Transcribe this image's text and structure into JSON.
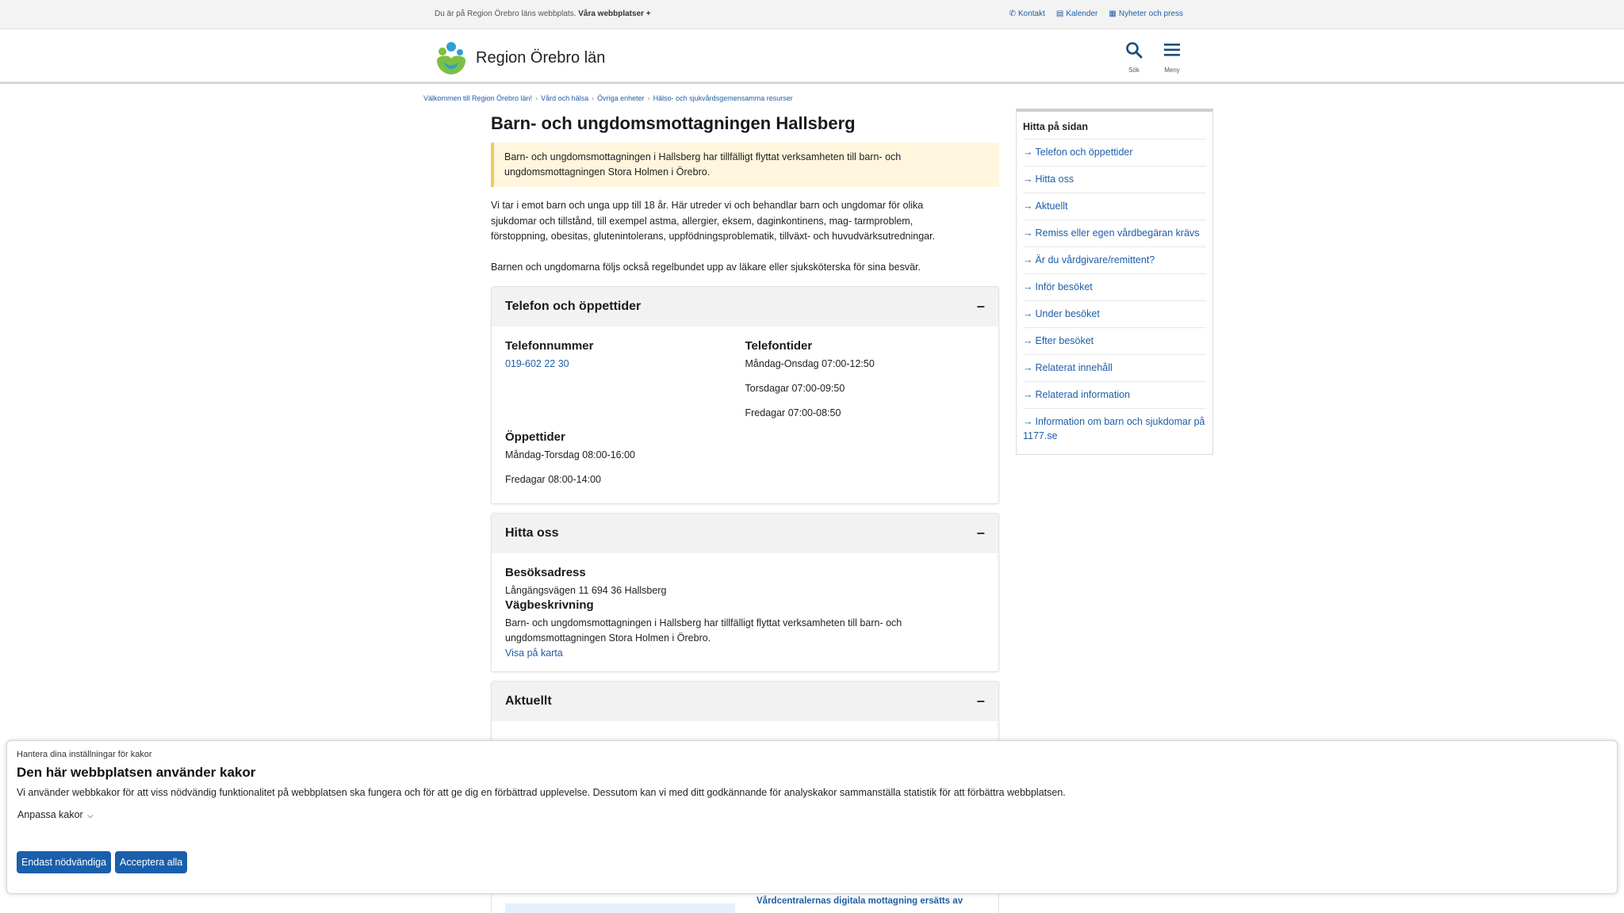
{
  "topbar": {
    "intro": "Du är på Region Örebro läns webbplats.",
    "our_sites": "Våra webbplatser +",
    "links": [
      {
        "icon": "phone-icon",
        "glyph": "📞",
        "label": "Kontakt"
      },
      {
        "icon": "calendar-icon",
        "glyph": "📅",
        "label": "Kalender"
      },
      {
        "icon": "news-icon",
        "glyph": "📰",
        "label": "Nyheter och press"
      }
    ]
  },
  "header": {
    "site_name": "Region Örebro län",
    "search_label": "Sök",
    "menu_label": "Meny"
  },
  "breadcrumb": [
    "Välkommen till Region Örebro län!",
    "Vård och hälsa",
    "Övriga enheter",
    "Hälso- och sjukvårdsgemensamma resurser"
  ],
  "page": {
    "title": "Barn- och ungdomsmottagningen Hallsberg",
    "notice_line1": "Barn- och ungdomsmottagningen i Hallsberg har tillfälligt flyttat verksamheten till barn- och",
    "notice_line2": "ungdomsmottagningen Stora Holmen i Örebro.",
    "intro_line1": "Vi tar i emot barn och unga upp till 18 år. Här utreder vi och behandlar barn och ungdomar för olika",
    "intro_line2": "sjukdomar och tillstånd, till exempel astma, allergier, eksem, daginkontinens, mag- tarmproblem,",
    "intro_line3": "förstoppning, obesitas, glutenintolerans, uppfödningsproblematik, tillväxt- och huvudvärksutredningar.",
    "followup": "Barnen och ungdomarna följs också regelbundet upp av läkare eller sjuksköterska för sina besvär."
  },
  "phone_section": {
    "title": "Telefon och öppettider",
    "toggle": "−",
    "phone_heading": "Telefonnummer",
    "phone_number": "019-602 22 30",
    "phone_times_heading": "Telefontider",
    "phone_times": [
      "Måndag-Onsdag 07:00-12:50",
      "Torsdagar 07:00-09:50",
      "Fredagar 07:00-08:50"
    ],
    "open_heading": "Öppettider",
    "open_times": [
      "Måndag-Torsdag 08:00-16:00",
      "Fredagar 08:00-14:00"
    ]
  },
  "find_section": {
    "title": "Hitta oss",
    "toggle": "−",
    "visit_heading": "Besöksadress",
    "visit_address": "Långängsvägen 11 694 36 Hallsberg",
    "directions_heading": "Vägbeskrivning",
    "directions_line1": "Barn- och ungdomsmottagningen i Hallsberg har tillfälligt flyttat verksamheten till barn- och",
    "directions_line2": "ungdomsmottagningen Stora Holmen i Örebro.",
    "map_link": "Visa på karta"
  },
  "news_section": {
    "title": "Aktuellt",
    "toggle": "−",
    "partial_link": "Vårdcentralernas digitala mottagning ersätts av"
  },
  "toc": {
    "heading": "Hitta på sidan",
    "items": [
      "Telefon och öppettider",
      "Hitta oss",
      "Aktuellt",
      "Remiss eller egen vårdbegäran krävs",
      "Är du vårdgivare/remittent?",
      "Inför besöket",
      "Under besöket",
      "Efter besöket",
      "Relaterat innehåll",
      "Relaterad information",
      "Information om barn och sjukdomar på 1177.se"
    ]
  },
  "cookie": {
    "kicker": "Hantera dina inställningar för kakor",
    "title": "Den här webbplatsen använder kakor",
    "body": "Vi använder webbkakor för att viss nödvändig funktionalitet på webbplatsen ska fungera och för att ge dig en förbättrad upplevelse. Dessutom kan vi med ditt godkännande för analyskakor sammanställa statistik för att förbättra webbplatsen.",
    "customize": "Anpassa kakor",
    "btn_necessary": "Endast nödvändiga",
    "btn_accept": "Acceptera alla"
  },
  "colors": {
    "link": "#1f5ea8",
    "button": "#1a5fab",
    "notice_bg": "#fff6dd",
    "notice_border": "#f5c95b"
  }
}
